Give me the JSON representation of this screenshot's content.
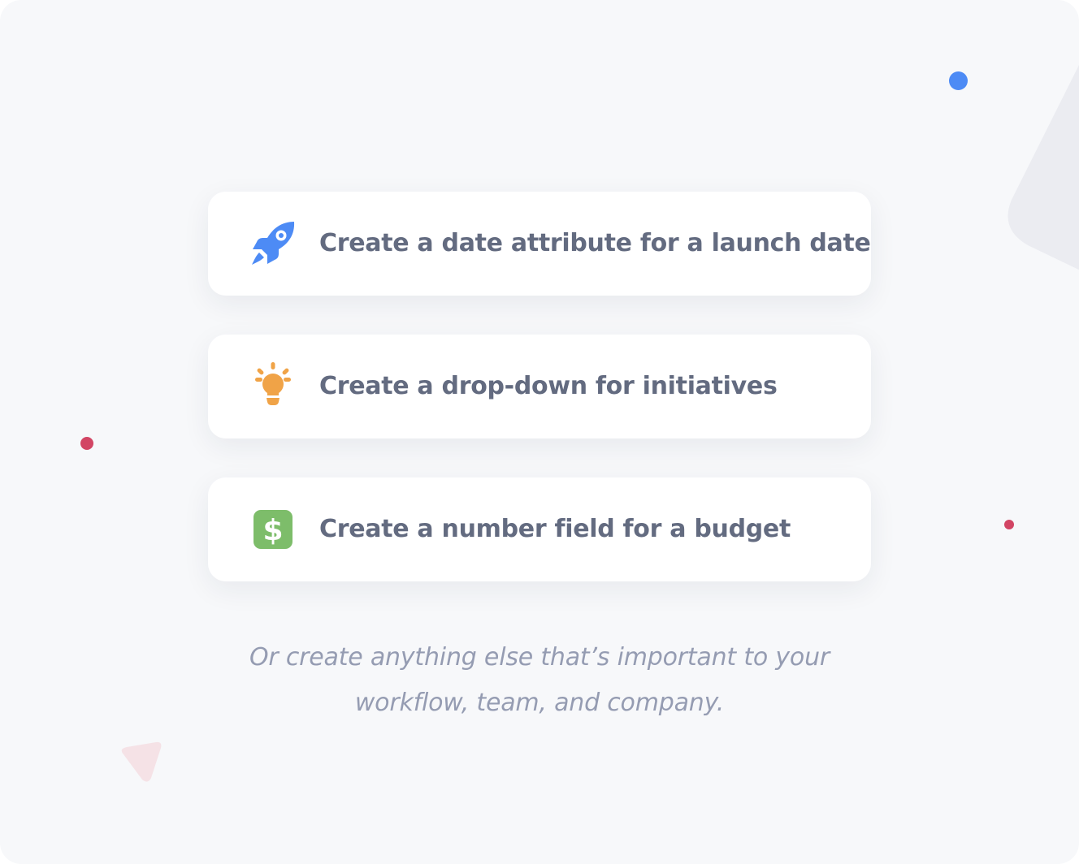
{
  "options": [
    {
      "label": "Create a date attribute for a launch date",
      "icon": "rocket-icon",
      "icon_color": "#4d8bf5"
    },
    {
      "label": "Create a drop-down for initiatives",
      "icon": "lightbulb-icon",
      "icon_color": "#f0a347"
    },
    {
      "label": "Create a number field for a budget",
      "icon": "dollar-icon",
      "icon_color": "#7dbd6a"
    }
  ],
  "footer": {
    "line1": "Or create anything else that’s important to your",
    "line2": "workflow, team, and company."
  },
  "colors": {
    "background": "#f7f8fa",
    "card": "#ffffff",
    "label_text": "#636b80",
    "footer_text": "#959cb2",
    "accent_blue": "#4d8bf5",
    "accent_red": "#d24564"
  }
}
